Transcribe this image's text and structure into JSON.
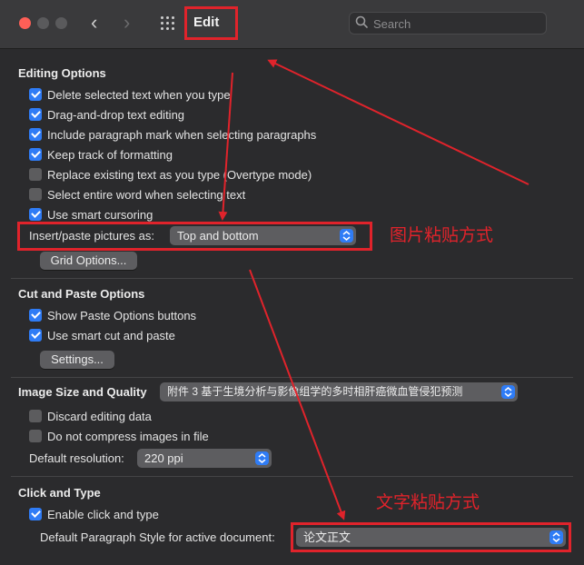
{
  "window": {
    "title": "Edit",
    "search_placeholder": "Search"
  },
  "editing_options": {
    "title": "Editing Options",
    "items": [
      {
        "label": "Delete selected text when you type",
        "checked": true
      },
      {
        "label": "Drag-and-drop text editing",
        "checked": true
      },
      {
        "label": "Include paragraph mark when selecting paragraphs",
        "checked": true
      },
      {
        "label": "Keep track of formatting",
        "checked": true
      },
      {
        "label": "Replace existing text as you type (Overtype mode)",
        "checked": false
      },
      {
        "label": "Select entire word when selecting text",
        "checked": false
      },
      {
        "label": "Use smart cursoring",
        "checked": true
      }
    ],
    "insert_label": "Insert/paste pictures as:",
    "insert_value": "Top and bottom",
    "grid_button": "Grid Options..."
  },
  "cut_paste": {
    "title": "Cut and Paste Options",
    "items": [
      {
        "label": "Show Paste Options buttons",
        "checked": true
      },
      {
        "label": "Use smart cut and paste",
        "checked": true
      }
    ],
    "settings_button": "Settings..."
  },
  "image_quality": {
    "title": "Image Size and Quality",
    "document": "附件 3  基于生境分析与影像组学的多时相肝癌微血管侵犯预测",
    "items": [
      {
        "label": "Discard editing data",
        "checked": false
      },
      {
        "label": "Do not compress images in file",
        "checked": false
      }
    ],
    "resolution_label": "Default resolution:",
    "resolution_value": "220 ppi"
  },
  "click_type": {
    "title": "Click and Type",
    "items": [
      {
        "label": "Enable click and type",
        "checked": true
      }
    ],
    "style_label": "Default Paragraph Style for active document:",
    "style_value": "论文正文"
  },
  "annotations": {
    "picture_paste": "图片粘贴方式",
    "text_paste": "文字粘贴方式"
  },
  "colors": {
    "accent": "#2f7cf6",
    "annotation": "#e0232b",
    "close": "#ff5f57"
  }
}
